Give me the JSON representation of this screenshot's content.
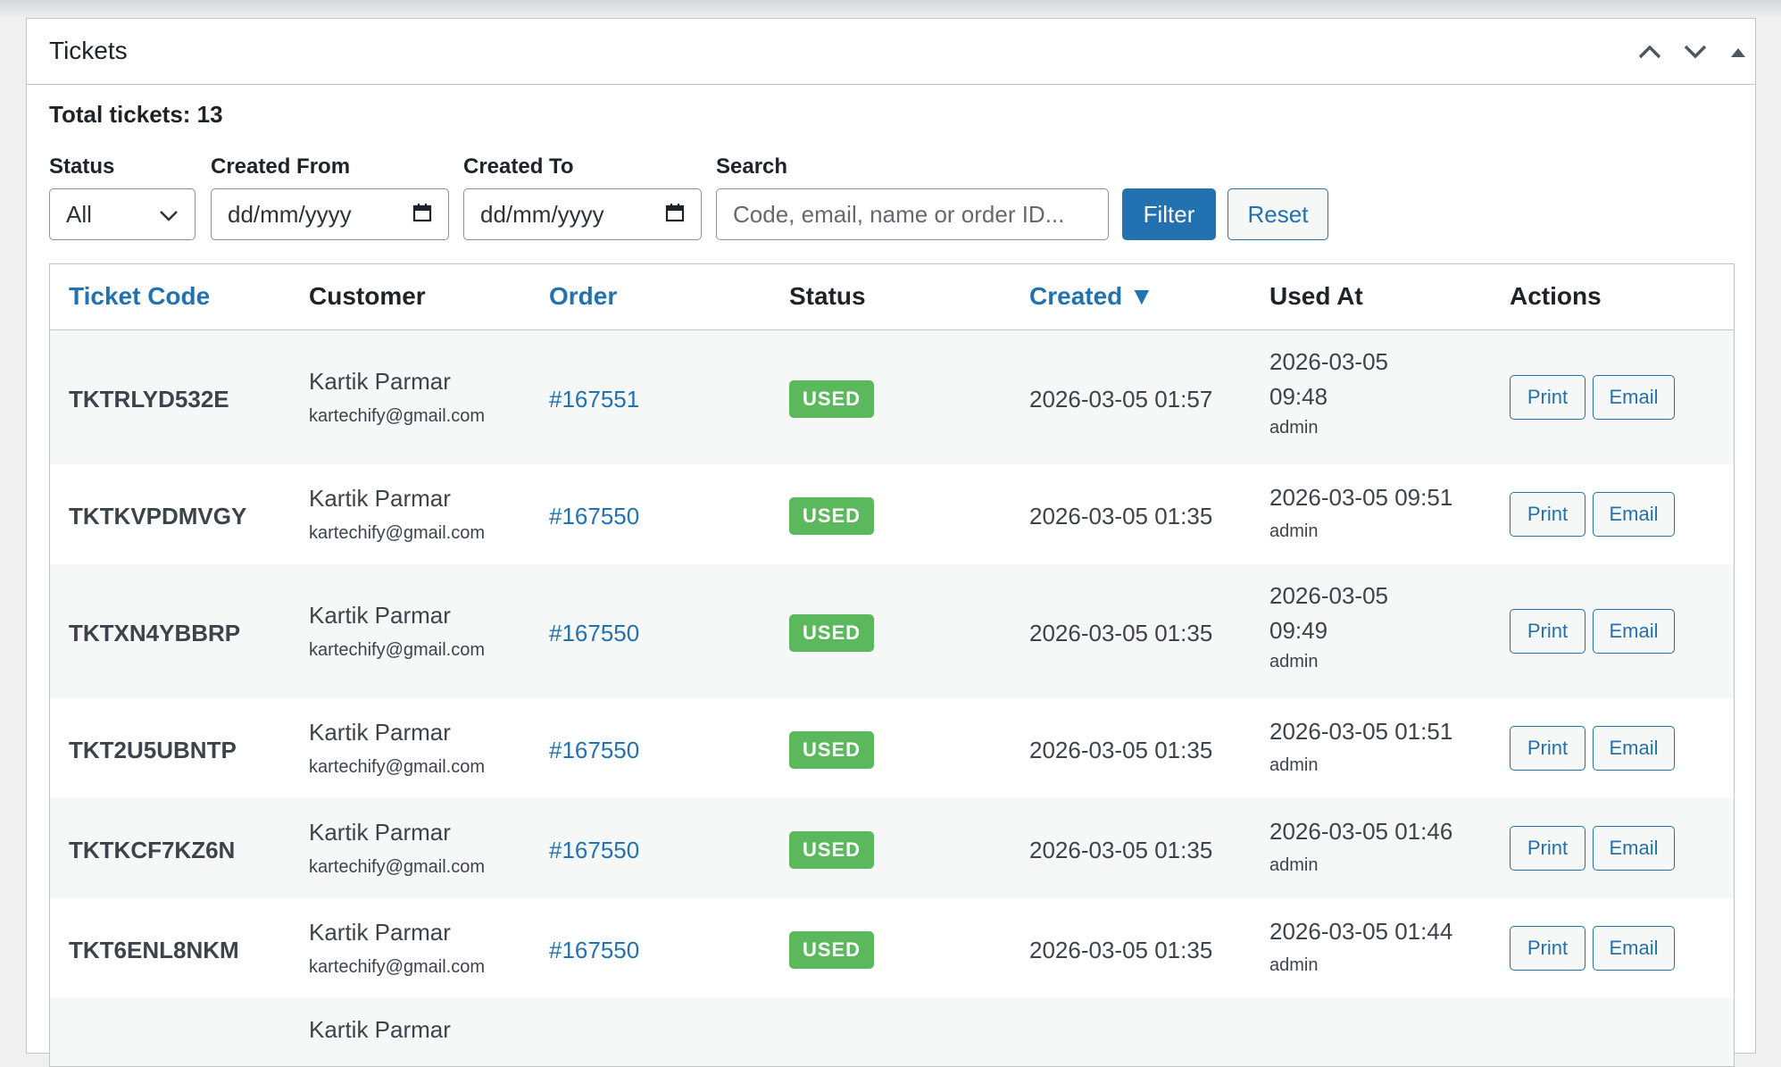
{
  "panel": {
    "title": "Tickets",
    "total_label": "Total tickets: 13"
  },
  "filters": {
    "status_label": "Status",
    "status_value": "All",
    "created_from_label": "Created From",
    "created_from_placeholder": "dd/mm/yyyy",
    "created_to_label": "Created To",
    "created_to_placeholder": "dd/mm/yyyy",
    "search_label": "Search",
    "search_placeholder": "Code, email, name or order ID...",
    "filter_button": "Filter",
    "reset_button": "Reset"
  },
  "table": {
    "headers": {
      "ticket_code": "Ticket Code",
      "customer": "Customer",
      "order": "Order",
      "status": "Status",
      "created": "Created ▼",
      "used_at": "Used At",
      "actions": "Actions"
    },
    "rows": [
      {
        "code": "TKTRLYD532E",
        "name": "Kartik Parmar",
        "email": "kartechify@gmail.com",
        "order": "#167551",
        "status": "USED",
        "created": "2026-03-05 01:57",
        "used_at": "2026-03-05 09:48",
        "used_by": "admin",
        "print": "Print",
        "email_btn": "Email"
      },
      {
        "code": "TKTKVPDMVGY",
        "name": "Kartik Parmar",
        "email": "kartechify@gmail.com",
        "order": "#167550",
        "status": "USED",
        "created": "2026-03-05 01:35",
        "used_at": "2026-03-05 09:51",
        "used_by": "admin",
        "print": "Print",
        "email_btn": "Email"
      },
      {
        "code": "TKTXN4YBBRP",
        "name": "Kartik Parmar",
        "email": "kartechify@gmail.com",
        "order": "#167550",
        "status": "USED",
        "created": "2026-03-05 01:35",
        "used_at": "2026-03-05 09:49",
        "used_by": "admin",
        "print": "Print",
        "email_btn": "Email"
      },
      {
        "code": "TKT2U5UBNTP",
        "name": "Kartik Parmar",
        "email": "kartechify@gmail.com",
        "order": "#167550",
        "status": "USED",
        "created": "2026-03-05 01:35",
        "used_at": "2026-03-05 01:51",
        "used_by": "admin",
        "print": "Print",
        "email_btn": "Email"
      },
      {
        "code": "TKTKCF7KZ6N",
        "name": "Kartik Parmar",
        "email": "kartechify@gmail.com",
        "order": "#167550",
        "status": "USED",
        "created": "2026-03-05 01:35",
        "used_at": "2026-03-05 01:46",
        "used_by": "admin",
        "print": "Print",
        "email_btn": "Email"
      },
      {
        "code": "TKT6ENL8NKM",
        "name": "Kartik Parmar",
        "email": "kartechify@gmail.com",
        "order": "#167550",
        "status": "USED",
        "created": "2026-03-05 01:35",
        "used_at": "2026-03-05 01:44",
        "used_by": "admin",
        "print": "Print",
        "email_btn": "Email"
      },
      {
        "name": "Kartik Parmar"
      }
    ]
  },
  "colors": {
    "accent": "#2271b1",
    "used_badge": "#5cb85c",
    "border": "#c3c4c7",
    "row_alt": "#f6f7f7"
  },
  "icons": {
    "move_up": "chevron-up-icon",
    "move_down": "chevron-down-icon",
    "toggle": "triangle-up-icon",
    "select": "chevron-down-icon",
    "date": "calendar-icon",
    "sort": "sort-down-icon"
  }
}
